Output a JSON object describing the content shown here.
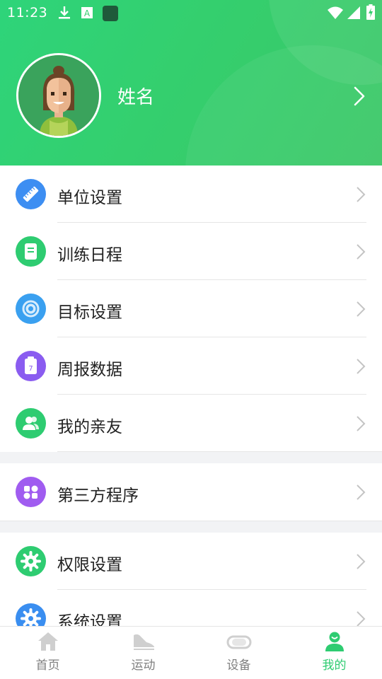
{
  "status_bar": {
    "time": "11:23"
  },
  "profile": {
    "name": "姓名"
  },
  "menu_groups": [
    [
      {
        "label": "单位设置",
        "icon": "ruler-pencil-icon",
        "color": "#3d8ef2"
      },
      {
        "label": "训练日程",
        "icon": "notebook-icon",
        "color": "#2ecc71"
      },
      {
        "label": "目标设置",
        "icon": "target-icon",
        "color": "#3aa0f0"
      },
      {
        "label": "周报数据",
        "icon": "calendar-icon",
        "color": "#8a5cf0"
      },
      {
        "label": "我的亲友",
        "icon": "friends-icon",
        "color": "#2ecc71"
      }
    ],
    [
      {
        "label": "第三方程序",
        "icon": "apps-icon",
        "color": "#a05cf0"
      }
    ],
    [
      {
        "label": "权限设置",
        "icon": "gear-icon",
        "color": "#2ecc71"
      },
      {
        "label": "系统设置",
        "icon": "gear-icon",
        "color": "#3a8ef0"
      }
    ]
  ],
  "tabs": [
    {
      "label": "首页",
      "icon": "home-icon",
      "active": false
    },
    {
      "label": "运动",
      "icon": "shoe-icon",
      "active": false
    },
    {
      "label": "设备",
      "icon": "band-icon",
      "active": false
    },
    {
      "label": "我的",
      "icon": "user-icon",
      "active": true
    }
  ],
  "colors": {
    "brand_green": "#2ecc71",
    "inactive_gray": "#7f7f7f"
  }
}
